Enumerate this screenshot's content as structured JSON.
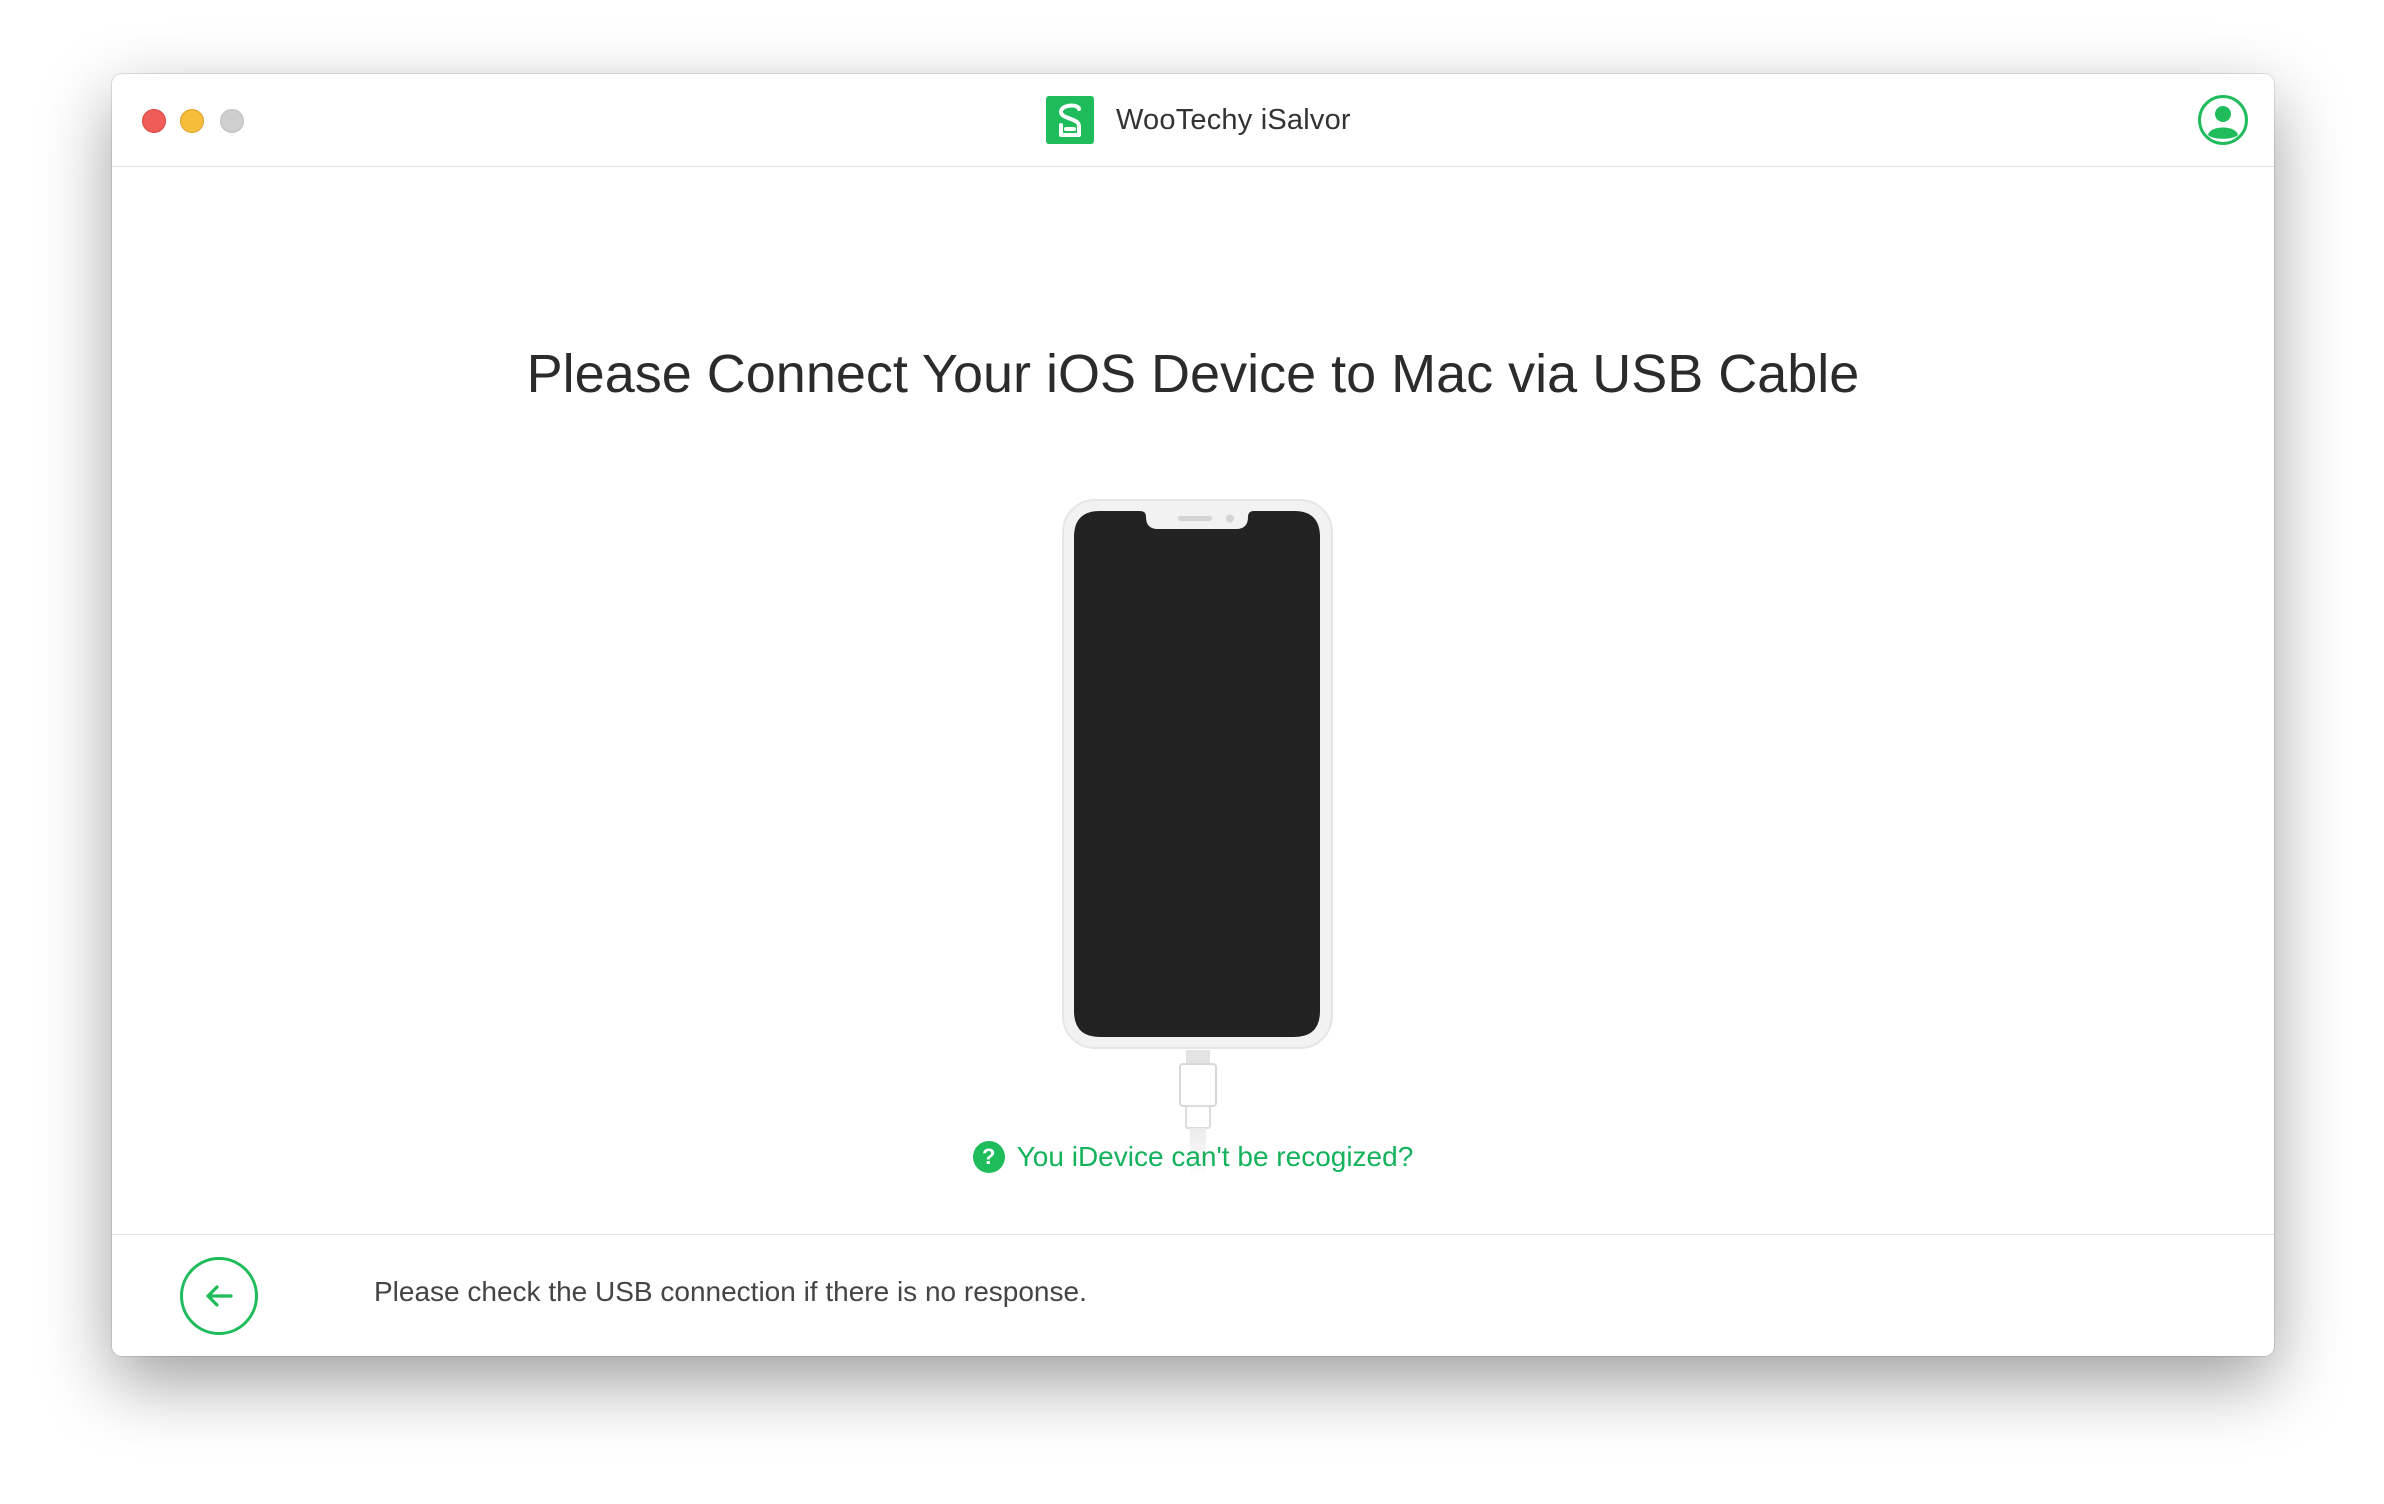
{
  "window": {
    "title": "WooTechy iSalvor"
  },
  "main": {
    "heading": "Please Connect Your iOS Device to Mac via USB Cable",
    "help_link": "You iDevice can't be recogized?",
    "help_icon_glyph": "?"
  },
  "footer": {
    "status_text": "Please check the USB connection if there is no response."
  },
  "icons": {
    "app_logo": "app-logo-icon",
    "user": "user-account-icon",
    "back": "back-arrow-icon",
    "help": "question-icon",
    "device": "iphone-illustration"
  },
  "colors": {
    "accent": "#1ebc5b",
    "close": "#ee5d58",
    "minimize": "#f5bd3a",
    "maximize": "#cfcfcf",
    "phone_screen": "#222222"
  }
}
